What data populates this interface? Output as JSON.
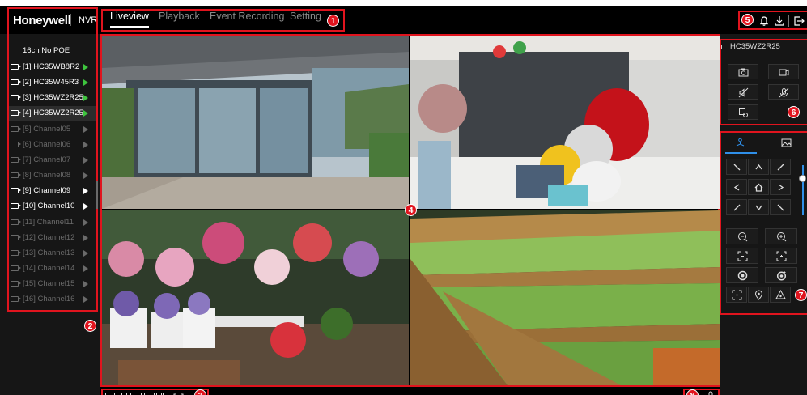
{
  "header": {
    "brand": "Honeywell",
    "product": "NVR",
    "tabs": [
      {
        "label": "Liveview",
        "active": true
      },
      {
        "label": "Playback",
        "active": false
      },
      {
        "label": "Event Recording",
        "active": false
      },
      {
        "label": "Setting",
        "active": false
      }
    ],
    "icons": [
      "alarm-bell-icon",
      "download-icon",
      "logout-icon"
    ]
  },
  "callouts": [
    "1",
    "2",
    "3",
    "4",
    "5",
    "6",
    "7",
    "8"
  ],
  "sidebar": {
    "device": "16ch No POE",
    "channels": [
      {
        "label": "[1] HC35WB8R2",
        "state": "streaming"
      },
      {
        "label": "[2] HC35W45R3",
        "state": "streaming"
      },
      {
        "label": "[3] HC35WZ2R25",
        "state": "streaming"
      },
      {
        "label": "[4] HC35WZ2R25",
        "state": "streaming-selected"
      },
      {
        "label": "[5] Channel05",
        "state": "offline"
      },
      {
        "label": "[6] Channel06",
        "state": "offline"
      },
      {
        "label": "[7] Channel07",
        "state": "offline"
      },
      {
        "label": "[8] Channel08",
        "state": "offline"
      },
      {
        "label": "[9] Channel09",
        "state": "online"
      },
      {
        "label": "[10] Channel10",
        "state": "online"
      },
      {
        "label": "[11] Channel11",
        "state": "offline"
      },
      {
        "label": "[12] Channel12",
        "state": "offline"
      },
      {
        "label": "[13] Channel13",
        "state": "offline"
      },
      {
        "label": "[14] Channel14",
        "state": "offline"
      },
      {
        "label": "[15] Channel15",
        "state": "offline"
      },
      {
        "label": "[16] Channel16",
        "state": "offline"
      }
    ]
  },
  "video": {
    "layout": "2x2",
    "tiles": [
      "office-entrance-feed",
      "toy-shelf-feed",
      "flower-shop-feed",
      "vegetable-aisle-feed"
    ]
  },
  "camera_panel": {
    "title": "HC35WZ2R25",
    "buttons": [
      "snapshot-icon",
      "record-icon",
      "audio-mute-icon",
      "talk-mute-icon",
      "digital-zoom-icon"
    ]
  },
  "ptz": {
    "tabs": [
      "ptz-tab-icon",
      "image-tab-icon"
    ],
    "speed_level": 0.8
  },
  "bottombar": {
    "layouts": [
      "layout-1-icon",
      "layout-4-icon",
      "layout-9-icon",
      "layout-16-icon",
      "fullscreen-icon"
    ],
    "right_icon": "microphone-icon"
  },
  "colors": {
    "accent_red": "#e0141e",
    "streaming_green": "#3ec43e",
    "active_blue": "#2f8fe8",
    "background": "#101010"
  }
}
